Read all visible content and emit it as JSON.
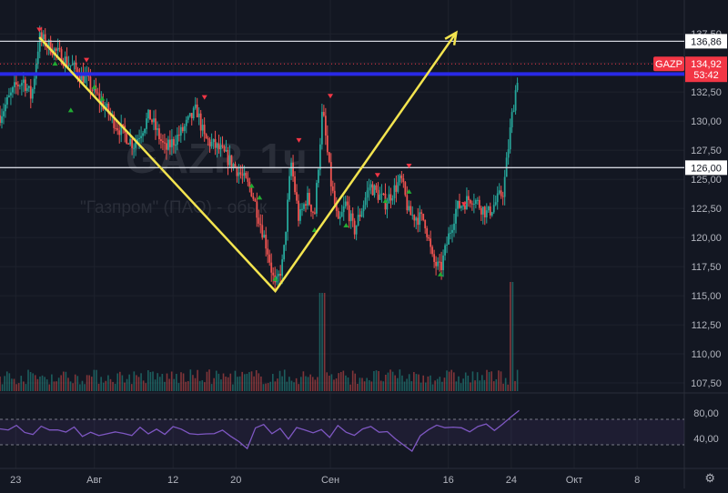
{
  "watermark": {
    "ticker": "GAZP, 1ч",
    "name": "\"Газпром\" (ПАО) - обык"
  },
  "chart_data": {
    "type": "candlestick",
    "symbol": "GAZP",
    "timeframe": "1ч",
    "y_ticks": [
      "137,50",
      "135,00",
      "132,50",
      "130,00",
      "127,50",
      "125,00",
      "122,50",
      "120,00",
      "117,50",
      "115,00",
      "112,50",
      "110,00",
      "107,50"
    ],
    "ylim": [
      106.8,
      139.0
    ],
    "x_ticks": [
      {
        "label": "23",
        "t": 2
      },
      {
        "label": "Авг",
        "t": 12
      },
      {
        "label": "12",
        "t": 22
      },
      {
        "label": "20",
        "t": 30
      },
      {
        "label": "Сен",
        "t": 42
      },
      {
        "label": "16",
        "t": 57
      },
      {
        "label": "24",
        "t": 65
      },
      {
        "label": "Окт",
        "t": 73
      },
      {
        "label": "8",
        "t": 81
      }
    ],
    "t_range": [
      0,
      87
    ],
    "price_path": [
      [
        0,
        130.5
      ],
      [
        2,
        133.0
      ],
      [
        3,
        133.5
      ],
      [
        4,
        132.0
      ],
      [
        5,
        137.2
      ],
      [
        7,
        136.0
      ],
      [
        9,
        134.8
      ],
      [
        11,
        133.5
      ],
      [
        13,
        131.5
      ],
      [
        15,
        129.5
      ],
      [
        17,
        128.0
      ],
      [
        19,
        130.5
      ],
      [
        21,
        127.5
      ],
      [
        23,
        129.0
      ],
      [
        25,
        131.0
      ],
      [
        26,
        128.5
      ],
      [
        28,
        127.5
      ],
      [
        30,
        126.0
      ],
      [
        32,
        124.0
      ],
      [
        33,
        121.5
      ],
      [
        34,
        119.0
      ],
      [
        35,
        115.6
      ],
      [
        36,
        118.0
      ],
      [
        37,
        126.5
      ],
      [
        38,
        121.5
      ],
      [
        39,
        123.5
      ],
      [
        40,
        122.0
      ],
      [
        41,
        131.0
      ],
      [
        42,
        125.0
      ],
      [
        43,
        121.0
      ],
      [
        44,
        123.0
      ],
      [
        45,
        120.5
      ],
      [
        47,
        124.5
      ],
      [
        49,
        123.0
      ],
      [
        51,
        125.0
      ],
      [
        52,
        122.0
      ],
      [
        54,
        121.5
      ],
      [
        55,
        118.0
      ],
      [
        56,
        117.2
      ],
      [
        57,
        120.0
      ],
      [
        58,
        122.5
      ],
      [
        60,
        123.5
      ],
      [
        62,
        122.0
      ],
      [
        63,
        123.0
      ],
      [
        64,
        124.0
      ],
      [
        65,
        130.0
      ],
      [
        66,
        134.8
      ]
    ],
    "horizontal_levels": [
      {
        "value": 136.86,
        "label": "136,86",
        "color": "#d1d4dc"
      },
      {
        "value": 126.0,
        "label": "126,00",
        "color": "#d1d4dc"
      }
    ],
    "blue_line": {
      "value": 134.05,
      "color": "#2929e6"
    },
    "current_price": {
      "value": 134.92,
      "symbol_label": "GAZP",
      "price_label": "134,92",
      "countdown": "53:42",
      "color": "#f23645"
    },
    "annotation_path": [
      [
        5,
        137.2
      ],
      [
        35,
        115.4
      ],
      [
        58,
        137.6
      ]
    ],
    "annotation_color": "#f3e44f",
    "sell_signals": [
      [
        5,
        137.8
      ],
      [
        11,
        135.2
      ],
      [
        26,
        132.0
      ],
      [
        38,
        128.3
      ],
      [
        42,
        132.1
      ],
      [
        48,
        125.3
      ],
      [
        52,
        126.1
      ],
      [
        59,
        122.8
      ]
    ],
    "buy_signals": [
      [
        7,
        135.0
      ],
      [
        9,
        131.0
      ],
      [
        12,
        133.0
      ],
      [
        13,
        132.0
      ],
      [
        32,
        124.5
      ],
      [
        33,
        123.5
      ],
      [
        35,
        116.5
      ],
      [
        40,
        120.7
      ],
      [
        44,
        121.1
      ],
      [
        49,
        123.2
      ],
      [
        52,
        124.0
      ],
      [
        56,
        116.9
      ]
    ],
    "volume": {
      "spike_t": [
        41,
        65
      ],
      "spike_value": [
        0.9,
        1.0
      ]
    },
    "rsi": {
      "ticks": [
        "80,00",
        "40,00"
      ],
      "band": [
        70,
        30
      ],
      "ylim": [
        0,
        100
      ],
      "values": [
        55,
        52,
        58,
        50,
        48,
        60,
        56,
        52,
        47,
        55,
        45,
        50,
        44,
        48,
        52,
        46,
        43,
        58,
        50,
        54,
        48,
        60,
        52,
        47,
        44,
        50,
        46,
        52,
        42,
        38,
        25,
        55,
        62,
        45,
        58,
        40,
        60,
        55,
        48,
        52,
        44,
        58,
        50,
        46,
        55,
        60,
        48,
        52,
        40,
        30,
        22,
        46,
        55,
        58,
        54,
        60,
        56,
        50,
        58,
        62,
        55,
        60,
        72,
        84
      ]
    },
    "colors": {
      "up": "#26a69a",
      "down": "#ef5350",
      "rsi": "#7e57c2",
      "grid": "#1e222d",
      "axis_text": "#b2b5be"
    }
  }
}
